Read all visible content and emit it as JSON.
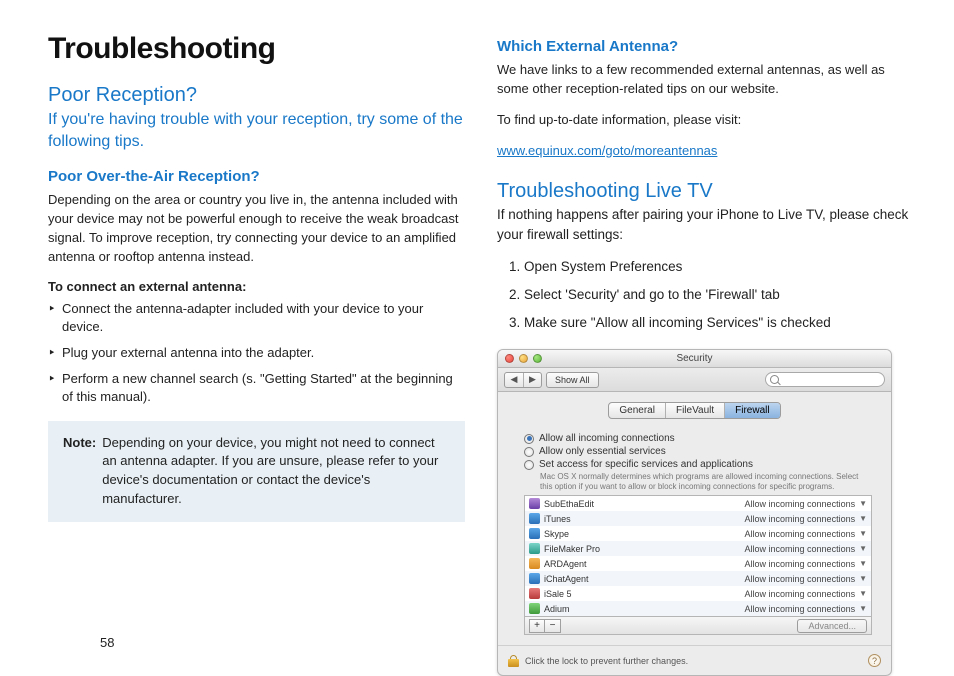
{
  "page_number": "58",
  "title": "Troubleshooting",
  "left": {
    "section_h": "Poor Reception?",
    "lead": "If you're having trouble with your reception, try some of the following tips.",
    "sub_h": "Poor Over-the-Air Reception?",
    "p1": "Depending on the area or country you live in, the antenna included with your device may not be powerful enough to receive the weak broadcast signal.  To improve reception, try connecting your device to an amplified antenna or rooftop antenna instead.",
    "bold": "To connect an external antenna:",
    "bullets": [
      "Connect the antenna-adapter included with your device to your device.",
      "Plug your external antenna into the adapter.",
      "Perform a new channel search (s. \"Getting Started\" at the beginning of this manual)."
    ],
    "note_label": "Note:",
    "note_text": "Depending on your device, you might not need to connect an antenna adapter. If you are unsure, please refer to your device's documentation or contact the device's manufacturer."
  },
  "right": {
    "sub_h1": "Which External Antenna?",
    "p1": "We have links to a few recommended external antennas, as well as some other reception-related tips on our website.",
    "p2": "To find up-to-date information, please visit:",
    "link": "www.equinux.com/goto/moreantennas",
    "section_h2": "Troubleshooting Live TV",
    "p3": "If nothing happens after pairing your iPhone to Live TV, please check your firewall settings:",
    "steps": [
      "Open System Preferences",
      "Select 'Security' and go to the 'Firewall' tab",
      "Make sure \"Allow all incoming Services\" is checked"
    ]
  },
  "prefs": {
    "title": "Security",
    "show_all": "Show All",
    "tabs": [
      "General",
      "FileVault",
      "Firewall"
    ],
    "active_tab": 2,
    "radios": [
      "Allow all incoming connections",
      "Allow only essential services",
      "Set access for specific services and applications"
    ],
    "hint": "Mac OS X normally determines which programs are allowed incoming connections. Select this option if you want to allow or block incoming connections for specific programs.",
    "perm_label": "Allow incoming connections",
    "apps": [
      {
        "name": "SubEthaEdit",
        "color": "purple"
      },
      {
        "name": "iTunes",
        "color": "blue"
      },
      {
        "name": "Skype",
        "color": "blue"
      },
      {
        "name": "FileMaker Pro",
        "color": "teal"
      },
      {
        "name": "ARDAgent",
        "color": "orange"
      },
      {
        "name": "iChatAgent",
        "color": "blue"
      },
      {
        "name": "iSale 5",
        "color": "red"
      },
      {
        "name": "Adium",
        "color": "green"
      }
    ],
    "advanced": "Advanced...",
    "lock_text": "Click the lock to prevent further changes.",
    "help": "?"
  }
}
